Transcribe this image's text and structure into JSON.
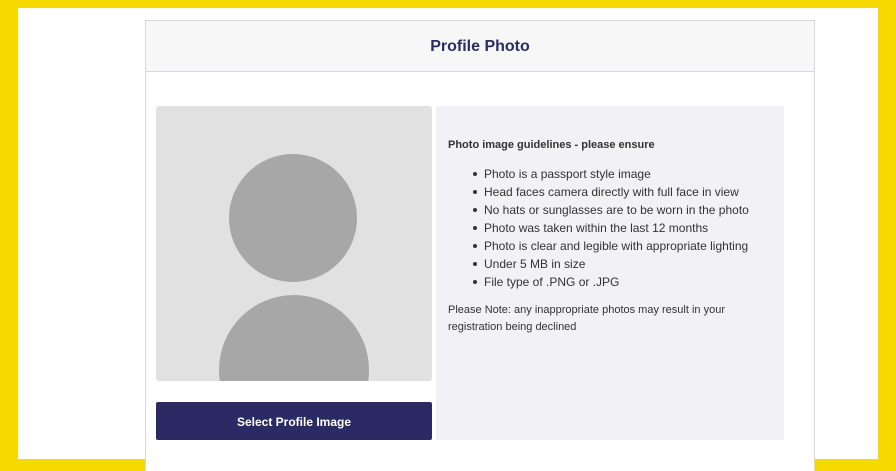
{
  "card": {
    "title": "Profile Photo"
  },
  "photo": {
    "placeholder_icon": "avatar-placeholder-icon",
    "select_button_label": "Select Profile Image"
  },
  "guidelines": {
    "heading": "Photo image guidelines - please ensure",
    "items": [
      "Photo is a passport style image",
      "Head faces camera directly with full face in view",
      "No hats or sunglasses are to be worn in the photo",
      "Photo was taken within the last 12 months",
      "Photo is clear and legible with appropriate lighting",
      "Under 5 MB in size",
      "File type of .PNG or .JPG"
    ],
    "note": "Please Note: any inappropriate photos may result in your registration being declined"
  },
  "colors": {
    "page_border": "#f7d900",
    "title": "#2b2c63",
    "button": "#2b2a64",
    "photo_bg": "#e1e1e1",
    "avatar": "#a7a7a7",
    "guidelines_bg": "#f1f1f6"
  }
}
